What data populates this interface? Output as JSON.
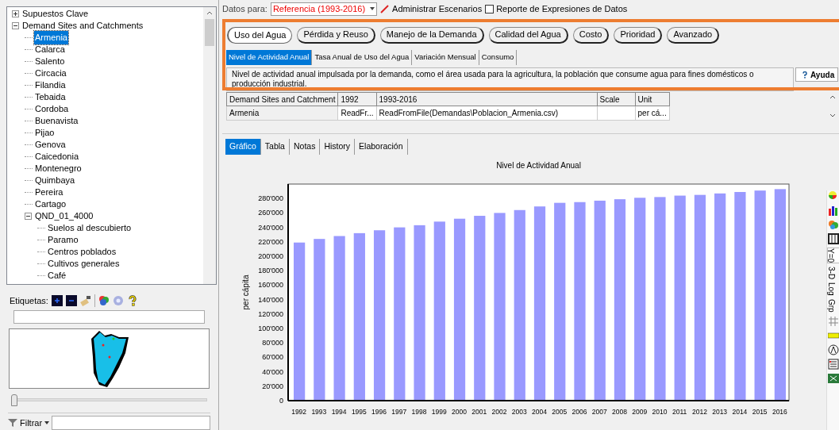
{
  "toolbar": {
    "data_for_label": "Datos para:",
    "scenario": "Referencia (1993-2016)",
    "manage_scenarios": "Administrar Escenarios",
    "report": "Reporte de Expresiones de Datos"
  },
  "tree": [
    {
      "label": "Supuestos Clave",
      "expanded": false,
      "selected": false
    },
    {
      "label": "Demand Sites and Catchments",
      "expanded": true,
      "selected": false,
      "children": [
        {
          "label": "Armenia",
          "selected": true
        },
        {
          "label": "Calarca",
          "selected": false
        },
        {
          "label": "Salento",
          "selected": false
        },
        {
          "label": "Circacia",
          "selected": false
        },
        {
          "label": "Filandia",
          "selected": false
        },
        {
          "label": "Tebaida",
          "selected": false
        },
        {
          "label": "Cordoba",
          "selected": false
        },
        {
          "label": "Buenavista",
          "selected": false
        },
        {
          "label": "Pijao",
          "selected": false
        },
        {
          "label": "Genova",
          "selected": false
        },
        {
          "label": "Caicedonia",
          "selected": false
        },
        {
          "label": "Montenegro",
          "selected": false
        },
        {
          "label": "Quimbaya",
          "selected": false
        },
        {
          "label": "Pereira",
          "selected": false
        },
        {
          "label": "Cartago",
          "selected": false
        },
        {
          "label": "QND_01_4000",
          "expanded": true,
          "selected": false,
          "children": [
            {
              "label": "Suelos al descubierto",
              "selected": false
            },
            {
              "label": "Paramo",
              "selected": false
            },
            {
              "label": "Centros poblados",
              "selected": false
            },
            {
              "label": "Cultivos generales",
              "selected": false
            },
            {
              "label": "Café",
              "selected": false
            }
          ]
        }
      ]
    }
  ],
  "labels_bar": {
    "label": "Etiquetas:"
  },
  "filter": {
    "label": "Filtrar"
  },
  "zoom_slider": {
    "level": 0
  },
  "categories": [
    {
      "label": "Uso del Agua",
      "selected": true
    },
    {
      "label": "Pérdida y Reuso",
      "selected": false
    },
    {
      "label": "Manejo de la Demanda",
      "selected": false
    },
    {
      "label": "Calidad del Agua",
      "selected": false
    },
    {
      "label": "Costo",
      "selected": false
    },
    {
      "label": "Prioridad",
      "selected": false
    },
    {
      "label": "Avanzado",
      "selected": false
    }
  ],
  "variable_tabs": [
    {
      "label": "Nivel de Actividad Anual",
      "selected": true
    },
    {
      "label": "Tasa Anual de Uso del Agua",
      "selected": false
    },
    {
      "label": "Variación Mensual",
      "selected": false
    },
    {
      "label": "Consumo",
      "selected": false
    }
  ],
  "description": "Nivel de actividad anual impulsada por la demanda, como el área usada para la agricultura, la población que consume agua para fines domésticos o producción industrial.",
  "help_button": "Ayuda",
  "table": {
    "columns": [
      "Demand Sites and Catchment",
      "1992",
      "1993-2016",
      "Scale",
      "Unit"
    ],
    "rows": [
      [
        "Armenia",
        "ReadFr...",
        "ReadFromFile(Demandas\\Poblacion_Armenia.csv)",
        "",
        "per cá..."
      ]
    ]
  },
  "view_tabs": [
    {
      "label": "Gráfico",
      "selected": true
    },
    {
      "label": "Tabla",
      "selected": false
    },
    {
      "label": "Notas",
      "selected": false
    },
    {
      "label": "History",
      "selected": false
    },
    {
      "label": "Elaboración",
      "selected": false
    }
  ],
  "chart_side_toggles": [
    {
      "label": "Y=0",
      "on": true
    },
    {
      "label": "3-D",
      "on": false
    },
    {
      "label": "Log",
      "on": false
    },
    {
      "label": "Grp",
      "on": false
    }
  ],
  "chart_data": {
    "type": "bar",
    "title": "Nivel de Actividad Anual",
    "ylabel": "per cápita",
    "categories": [
      "1992",
      "1993",
      "1994",
      "1995",
      "1996",
      "1997",
      "1998",
      "1999",
      "2000",
      "2001",
      "2002",
      "2003",
      "2004",
      "2005",
      "2006",
      "2007",
      "2008",
      "2009",
      "2010",
      "2011",
      "2012",
      "2013",
      "2014",
      "2015",
      "2016"
    ],
    "series": [
      {
        "color": "#9999ff",
        "values": [
          219000,
          224000,
          228000,
          232000,
          236000,
          240000,
          243000,
          248000,
          252000,
          256000,
          260000,
          264000,
          269000,
          274000,
          275000,
          277000,
          279000,
          281000,
          282000,
          284000,
          285000,
          287000,
          289000,
          291000,
          293000
        ]
      }
    ],
    "ylim": [
      0,
      300000
    ],
    "yticks": [
      {
        "value": 0,
        "label": "0"
      },
      {
        "value": 20000,
        "label": "20'000"
      },
      {
        "value": 40000,
        "label": "40'000"
      },
      {
        "value": 60000,
        "label": "60'000"
      },
      {
        "value": 80000,
        "label": "80'000"
      },
      {
        "value": 100000,
        "label": "100'000"
      },
      {
        "value": 120000,
        "label": "120'000"
      },
      {
        "value": 140000,
        "label": "140'000"
      },
      {
        "value": 160000,
        "label": "160'000"
      },
      {
        "value": 180000,
        "label": "180'000"
      },
      {
        "value": 200000,
        "label": "200'000"
      },
      {
        "value": 220000,
        "label": "220'000"
      },
      {
        "value": 240000,
        "label": "240'000"
      },
      {
        "value": 260000,
        "label": "260'000"
      },
      {
        "value": 280000,
        "label": "280'000"
      }
    ]
  }
}
